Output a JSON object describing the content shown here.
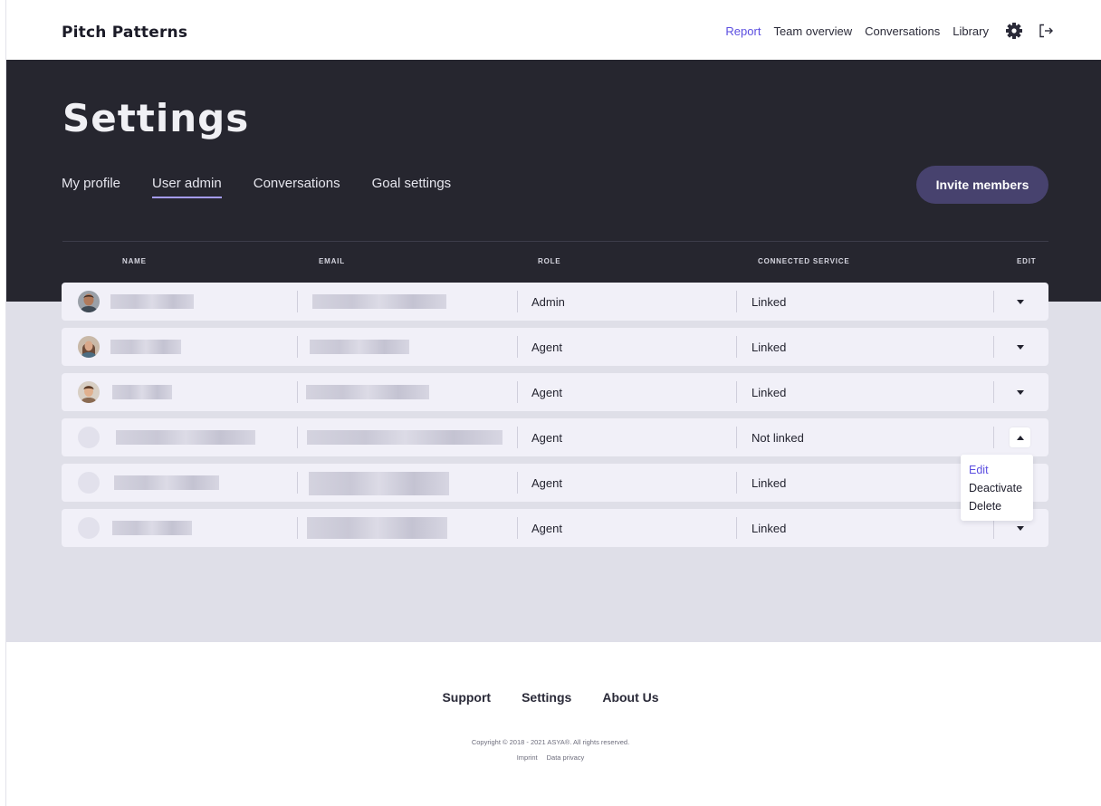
{
  "header": {
    "logo": "Pitch Patterns",
    "nav": [
      "Report",
      "Team overview",
      "Conversations",
      "Library"
    ],
    "active_nav": "Report",
    "icons": [
      "gear-icon",
      "logout-icon"
    ]
  },
  "page": {
    "title": "Settings",
    "tabs": [
      "My profile",
      "User admin",
      "Conversations",
      "Goal settings"
    ],
    "active_tab": "User admin",
    "invite_label": "Invite members"
  },
  "table": {
    "columns": [
      "NAME",
      "EMAIL",
      "ROLE",
      "CONNECTED SERVICE",
      "EDIT"
    ],
    "rows": [
      {
        "name": "",
        "email": "",
        "role": "Admin",
        "service": "Linked",
        "dropdown_open": false
      },
      {
        "name": "",
        "email": "",
        "role": "Agent",
        "service": "Linked",
        "dropdown_open": false
      },
      {
        "name": "",
        "email": "",
        "role": "Agent",
        "service": "Linked",
        "dropdown_open": false
      },
      {
        "name": "",
        "email": "",
        "role": "Agent",
        "service": "Not linked",
        "dropdown_open": true
      },
      {
        "name": "",
        "email": "",
        "role": "Agent",
        "service": "Linked",
        "dropdown_open": false
      },
      {
        "name": "",
        "email": "",
        "role": "Agent",
        "service": "Linked",
        "dropdown_open": false
      }
    ]
  },
  "dropdown_menu": {
    "items": [
      "Edit",
      "Deactivate",
      "Delete"
    ]
  },
  "footer": {
    "links": [
      "Support",
      "Settings",
      "About Us"
    ],
    "copyright": "Copyright © 2018 - 2021 ASYA®. All rights reserved.",
    "legal": [
      "Imprint",
      "Data privacy"
    ]
  },
  "colors": {
    "accent": "#5b4ee0",
    "hero_bg": "#26262f",
    "band_bg": "#dfdfe8",
    "invite_button": "#47426e"
  }
}
